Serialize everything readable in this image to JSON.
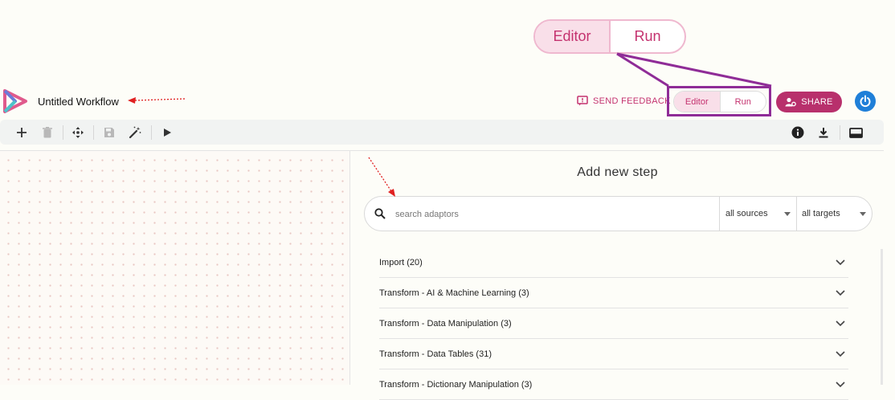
{
  "zoom_toggle": {
    "editor": "Editor",
    "run": "Run"
  },
  "header": {
    "title": "Untitled Workflow",
    "feedback_label": "SEND FEEDBACK",
    "toggle": {
      "editor": "Editor",
      "run": "Run"
    },
    "share_label": "SHARE"
  },
  "toolbar": {
    "left_icons": [
      "plus-icon",
      "trash-icon",
      "move-icon",
      "save-icon",
      "magic-wand-icon",
      "play-icon"
    ],
    "right_icons": [
      "info-icon",
      "download-icon",
      "panel-icon"
    ]
  },
  "panel": {
    "title": "Add new step",
    "search_placeholder": "search adaptors",
    "sources_value": "all sources",
    "targets_value": "all targets",
    "categories": [
      "Import (20)",
      "Transform - AI & Machine Learning (3)",
      "Transform - Data Manipulation (3)",
      "Transform - Data Tables (31)",
      "Transform - Dictionary Manipulation (3)"
    ]
  },
  "colors": {
    "brand": "#c4326f",
    "share_bg": "#b8306c",
    "highlight": "#8f2c97",
    "power": "#1f7fd8",
    "annotation": "#e02020"
  }
}
